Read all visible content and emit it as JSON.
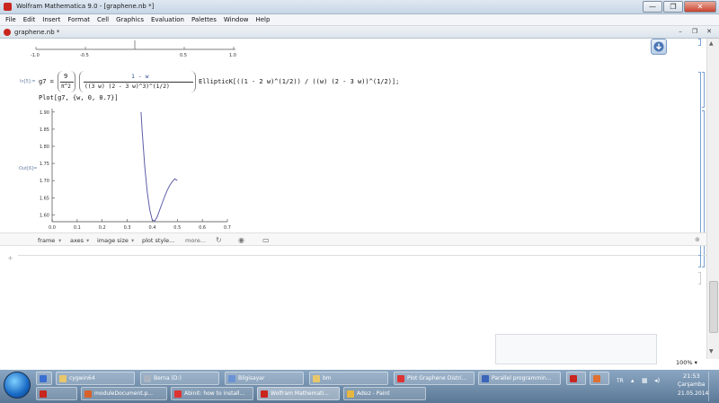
{
  "window": {
    "title": "Wolfram Mathematica 9.0 - [graphene.nb *]",
    "minimize": "—",
    "maximize": "❐",
    "close": "✕"
  },
  "menu": [
    "File",
    "Edit",
    "Insert",
    "Format",
    "Cell",
    "Graphics",
    "Evaluation",
    "Palettes",
    "Window",
    "Help"
  ],
  "document": {
    "title": "graphene.nb *",
    "close": "✕"
  },
  "prev_plot_ticks": [
    "-1.0",
    "-0.5",
    "0.5",
    "1.0"
  ],
  "input_cell": {
    "label": "In[5]:=",
    "lhs": "g7 =",
    "frac1_num": "9",
    "frac1_den": "π^2",
    "frac2_num": "1 - w",
    "frac2_den": "((3 w) (2 - 3 w)^3)^(1/2)",
    "tail": "EllipticK[((1 - 2 w)^(1/2)) / ((w) (2 - 3 w))^(1/2)];",
    "plot_cmd": "Plot[g7, {w, 0, 0.7}]"
  },
  "output_cell": {
    "label": "Out[6]="
  },
  "chart_data": {
    "type": "line",
    "title": "",
    "xlabel": "",
    "ylabel": "",
    "xlim": [
      0,
      0.7
    ],
    "ylim": [
      1.58,
      1.91
    ],
    "x_ticks": [
      "0.0",
      "0.1",
      "0.2",
      "0.3",
      "0.4",
      "0.5",
      "0.6",
      "0.7"
    ],
    "y_ticks": [
      "1.60",
      "1.65",
      "1.70",
      "1.75",
      "1.80",
      "1.85",
      "1.90"
    ],
    "series": [
      {
        "x": [
          0.355,
          0.36,
          0.37,
          0.38,
          0.39,
          0.4,
          0.41,
          0.42,
          0.43,
          0.44,
          0.45,
          0.46,
          0.47,
          0.48,
          0.49,
          0.5
        ],
        "y": [
          1.9,
          1.84,
          1.74,
          1.665,
          1.615,
          1.585,
          1.582,
          1.595,
          1.615,
          1.635,
          1.655,
          1.672,
          1.686,
          1.697,
          1.705,
          1.7
        ]
      }
    ],
    "line_color": "#5e5ea8"
  },
  "suggestion_bar": {
    "frame": "frame",
    "axes": "axes",
    "image_size": "image size",
    "plot_style": "plot style...",
    "more": "more..."
  },
  "zoom": "100%",
  "taskbar": {
    "top": [
      "cygwin64",
      "Berna (D:)",
      "Bilgisayar",
      "bm",
      "Plot Graphene Distri...",
      "Parallel programmin..."
    ],
    "bottom": [
      "moduleDocument.p...",
      "Abinit: how to install...",
      "Wolfram Mathemati...",
      "Adsız - Paint"
    ],
    "lang": "TR",
    "time": "21:53",
    "day": "Çarşamba",
    "date": "21.05.2014"
  }
}
